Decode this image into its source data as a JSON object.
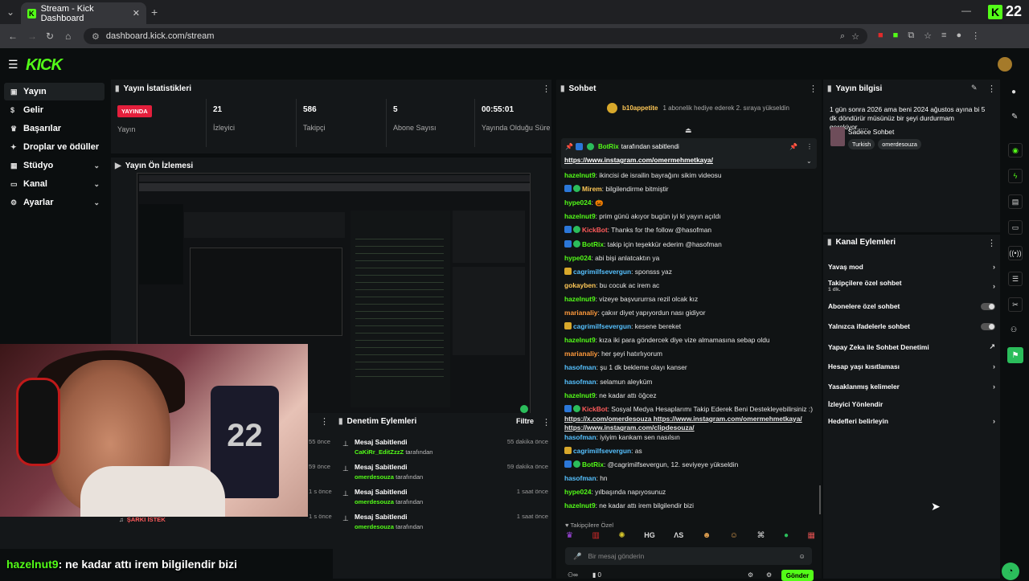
{
  "browser": {
    "tab_title": "Stream - Kick Dashboard",
    "url": "dashboard.kick.com/stream",
    "kick_count": "22"
  },
  "app": {
    "logo": "KICK"
  },
  "sidebar": {
    "items": [
      {
        "label": "Yayın",
        "icon": "broadcast-icon",
        "expand": false
      },
      {
        "label": "Gelir",
        "icon": "money-icon",
        "expand": false
      },
      {
        "label": "Başarılar",
        "icon": "trophy-icon",
        "expand": false
      },
      {
        "label": "Droplar ve ödüller",
        "icon": "gift-icon",
        "expand": false
      },
      {
        "label": "Stüdyo",
        "icon": "studio-icon",
        "expand": true
      },
      {
        "label": "Kanal",
        "icon": "channel-icon",
        "expand": true
      },
      {
        "label": "Ayarlar",
        "icon": "settings-icon",
        "expand": true
      }
    ]
  },
  "stats": {
    "title": "Yayın İstatistikleri",
    "items": [
      {
        "value": "YAYINDA",
        "label": "Yayın"
      },
      {
        "value": "21",
        "label": "İzleyici"
      },
      {
        "value": "586",
        "label": "Takipçi"
      },
      {
        "value": "5",
        "label": "Abone Sayısı"
      },
      {
        "value": "00:55:01",
        "label": "Yayında Olduğu Süre"
      }
    ]
  },
  "preview": {
    "title": "Yayın Ön İzlemesi"
  },
  "modlog": {
    "title": "Denetim Eylemleri",
    "filter": "Filtre",
    "items": [
      {
        "title": "Mesaj Sabitlendi",
        "by": "CaKiRr_EditZzzZ",
        "by_suffix": "tarafından",
        "time": "55 dakika önce"
      },
      {
        "title": "Mesaj Sabitlendi",
        "by": "omerdesouza",
        "by_suffix": "tarafından",
        "time": "59 dakika önce"
      },
      {
        "title": "Mesaj Sabitlendi",
        "by": "omerdesouza",
        "by_suffix": "tarafından",
        "time": "1 saat önce"
      },
      {
        "title": "Mesaj Sabitlendi",
        "by": "omerdesouza",
        "by_suffix": "tarafından",
        "time": "1 saat önce"
      }
    ],
    "partial_times": [
      "55 önce",
      "59 önce",
      "1 s önce",
      "1 s önce"
    ]
  },
  "overlay": {
    "bottom_user": "hazelnut9",
    "bottom_msg": ": ne kadar attı irem bilgilendir bizi",
    "song_request": "ŞARKI İSTEK"
  },
  "chat": {
    "title": "Sohbet",
    "gift_user": "b10appetite",
    "gift_text": "1 abonelik hediye ederek 2. sıraya yükseldin",
    "pinned_by": "BotRix",
    "pinned_suffix": "tarafından sabitlendi",
    "pinned_link": "https://www.instagram.com/omermehmetkaya/",
    "messages": [
      {
        "user": "hazelnut9",
        "cls": "g",
        "text": ": ikincisi de israilin bayrağını sikim videosu"
      },
      {
        "user": "Mirem",
        "cls": "p",
        "text": ": bilgilendirme bitmiştir"
      },
      {
        "user": "hype024",
        "cls": "g",
        "text": ": 🎃"
      },
      {
        "user": "hazelnut9",
        "cls": "g",
        "text": ": prim günü akıyor bugün iyi kl yayın açıldı"
      },
      {
        "user": "KickBot",
        "cls": "r",
        "text": ": Thanks for the follow @hasofman"
      },
      {
        "user": "BotRix",
        "cls": "g",
        "text": ": takip için teşekkür ederim @hasofman"
      },
      {
        "user": "hype024",
        "cls": "g",
        "text": ": abi bişi anlatcaktın ya"
      },
      {
        "user": "cagrimilfsevergun",
        "cls": "c",
        "text": ": sponsss yaz"
      },
      {
        "user": "gokayben",
        "cls": "p",
        "text": ": bu cocuk ac irem ac"
      },
      {
        "user": "hazelnut9",
        "cls": "g",
        "text": ": vizeye başvururrsa rezil olcak kız"
      },
      {
        "user": "marianaliy",
        "cls": "o",
        "text": ": çakıır diyet yapıyordun nası gidiyor"
      },
      {
        "user": "cagrimilfsevergun",
        "cls": "c",
        "text": ": kesene bereket"
      },
      {
        "user": "hazelnut9",
        "cls": "g",
        "text": ": kıza iki para göndercek diye vize almamasına sebap oldu"
      },
      {
        "user": "marianaliy",
        "cls": "o",
        "text": ": her şeyi hatırlıyorum"
      },
      {
        "user": "hasofman",
        "cls": "c",
        "text": ": şu 1 dk bekleme olayı kanser"
      },
      {
        "user": "hasofman",
        "cls": "c",
        "text": ": selamun aleyküm"
      },
      {
        "user": "hazelnut9",
        "cls": "g",
        "text": ": ne kadar attı öğcez"
      },
      {
        "user": "KickBot",
        "cls": "r",
        "text": ": Sosyal Medya Hesaplarımı Takip Ederek Beni Destekleyebilirsiniz :)"
      },
      {
        "user": "",
        "cls": "g",
        "text": "https://x.com/omerdesouza https://www.instagram.com/omermehmetkaya/"
      },
      {
        "user": "",
        "cls": "g",
        "text": "https://www.instagram.com/clipdesouza/"
      },
      {
        "user": "hasofman",
        "cls": "c",
        "text": ": iyiyim kankam sen nasılsın"
      },
      {
        "user": "cagrimilfsevergun",
        "cls": "c",
        "text": ": as"
      },
      {
        "user": "BotRix",
        "cls": "g",
        "text": ": @cagrimilfsevergun, 12. seviyeye yükseldin"
      },
      {
        "user": "hasofman",
        "cls": "c",
        "text": ": hn"
      },
      {
        "user": "hype024",
        "cls": "g",
        "text": ": yılbaşında napıyosunuz"
      },
      {
        "user": "hazelnut9",
        "cls": "g",
        "text": ": ne kadar attı irem bilgilendir bizi"
      }
    ],
    "followers_only": "Takipçilere Özel",
    "input_placeholder": "Bir mesaj gönderin",
    "send": "Gönder",
    "emote_count": "0"
  },
  "info": {
    "title": "Yayın bilgisi",
    "text": "1 gün sonra 2026 ama beni 2024 ağustos ayına bi 5 dk döndürür müsünüz bir şeyi durdurmam gerekiyor......",
    "category": "Sadece Sohbet",
    "tags": [
      "Turkish",
      "omerdesouza"
    ]
  },
  "actions": {
    "title": "Kanal Eylemleri",
    "items": [
      {
        "label": "Yavaş mod",
        "kind": "arrow"
      },
      {
        "label": "Takipçilere özel sohbet",
        "sub": "1 dk.",
        "kind": "arrow"
      },
      {
        "label": "Abonelere özel sohbet",
        "kind": "toggle"
      },
      {
        "label": "Yalnızca ifadelerle sohbet",
        "kind": "toggle"
      },
      {
        "label": "Yapay Zeka ile Sohbet Denetimi",
        "kind": "ext"
      },
      {
        "label": "Hesap yaşı kısıtlaması",
        "kind": "arrow"
      },
      {
        "label": "Yasaklanmış kelimeler",
        "kind": "arrow"
      },
      {
        "label": "İzleyici Yönlendir",
        "kind": "none"
      },
      {
        "label": "Hedefleri belirleyin",
        "kind": "arrow"
      }
    ]
  },
  "colors": {
    "accent": "#53fc18",
    "live": "#e41f3c",
    "panel": "#141719",
    "bg": "#0b0e0f"
  }
}
